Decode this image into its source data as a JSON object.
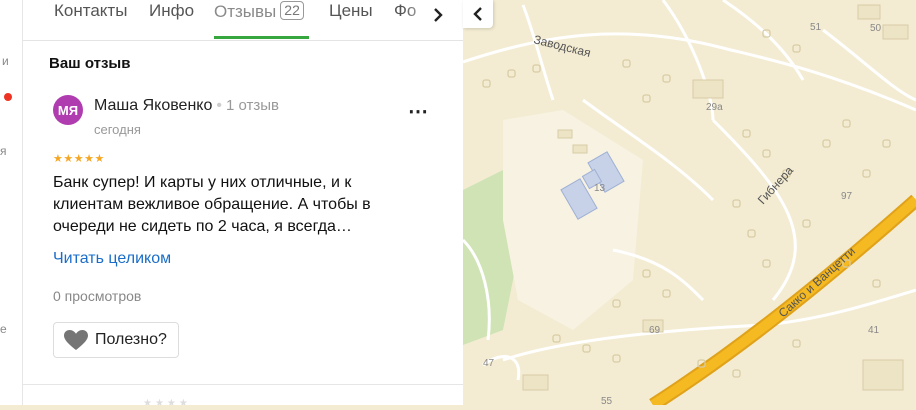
{
  "left_strip": {
    "items": [
      "и",
      "я",
      "е"
    ]
  },
  "tabs": [
    {
      "label": "Контакты"
    },
    {
      "label": "Инфо"
    },
    {
      "label": "Отзывы",
      "count": "22",
      "active": true
    },
    {
      "label": "Цены"
    },
    {
      "label": "Фо"
    }
  ],
  "icons": {
    "next": "chevron-right-icon",
    "collapse": "chevron-left-icon",
    "like": "heart-icon",
    "more": "more-dots-icon"
  },
  "review": {
    "section_title": "Ваш отзыв",
    "avatar_initials": "МЯ",
    "author": "Маша Яковенко",
    "separator": "•",
    "author_reviews": "1 отзыв",
    "date": "сегодня",
    "more": "⋯",
    "rating": 5,
    "stars": "★★★★★",
    "text": "Банк супер! И карты у них отличные, и к клиентам вежливое обращение. А чтобы в очереди не сидеть по 2 часа, я всегда…",
    "read_more": "Читать целиком",
    "views": "0 просмотров",
    "useful": "Полезно?"
  },
  "map": {
    "streets": [
      "Заводская",
      "Гибнера",
      "Сакко и Ванцетти"
    ],
    "house_numbers": [
      "51",
      "50",
      "29а",
      "13",
      "97",
      "69",
      "41",
      "47",
      "55"
    ]
  },
  "colors": {
    "accent_green": "#36a63f",
    "link": "#1a6ec8",
    "avatar": "#b03db0",
    "star": "#f5a623",
    "road_main": "#f5b921"
  }
}
